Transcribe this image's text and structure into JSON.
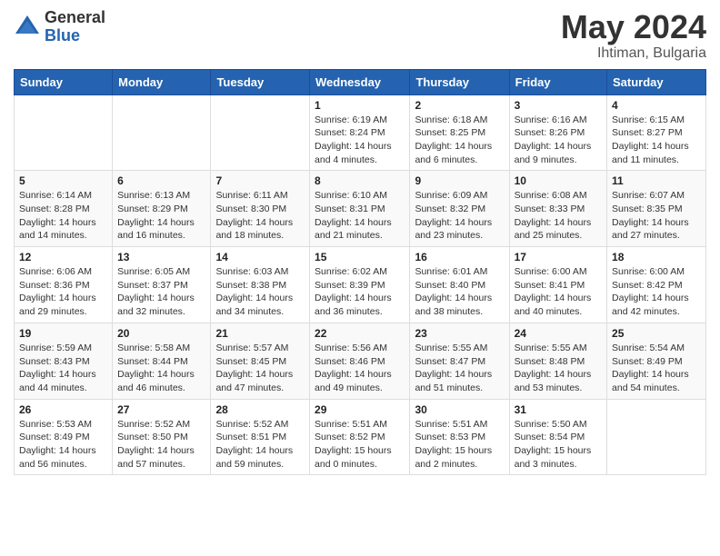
{
  "header": {
    "logo_general": "General",
    "logo_blue": "Blue",
    "title": "May 2024",
    "location": "Ihtiman, Bulgaria"
  },
  "days_of_week": [
    "Sunday",
    "Monday",
    "Tuesday",
    "Wednesday",
    "Thursday",
    "Friday",
    "Saturday"
  ],
  "weeks": [
    [
      {
        "num": "",
        "info": ""
      },
      {
        "num": "",
        "info": ""
      },
      {
        "num": "",
        "info": ""
      },
      {
        "num": "1",
        "info": "Sunrise: 6:19 AM\nSunset: 8:24 PM\nDaylight: 14 hours\nand 4 minutes."
      },
      {
        "num": "2",
        "info": "Sunrise: 6:18 AM\nSunset: 8:25 PM\nDaylight: 14 hours\nand 6 minutes."
      },
      {
        "num": "3",
        "info": "Sunrise: 6:16 AM\nSunset: 8:26 PM\nDaylight: 14 hours\nand 9 minutes."
      },
      {
        "num": "4",
        "info": "Sunrise: 6:15 AM\nSunset: 8:27 PM\nDaylight: 14 hours\nand 11 minutes."
      }
    ],
    [
      {
        "num": "5",
        "info": "Sunrise: 6:14 AM\nSunset: 8:28 PM\nDaylight: 14 hours\nand 14 minutes."
      },
      {
        "num": "6",
        "info": "Sunrise: 6:13 AM\nSunset: 8:29 PM\nDaylight: 14 hours\nand 16 minutes."
      },
      {
        "num": "7",
        "info": "Sunrise: 6:11 AM\nSunset: 8:30 PM\nDaylight: 14 hours\nand 18 minutes."
      },
      {
        "num": "8",
        "info": "Sunrise: 6:10 AM\nSunset: 8:31 PM\nDaylight: 14 hours\nand 21 minutes."
      },
      {
        "num": "9",
        "info": "Sunrise: 6:09 AM\nSunset: 8:32 PM\nDaylight: 14 hours\nand 23 minutes."
      },
      {
        "num": "10",
        "info": "Sunrise: 6:08 AM\nSunset: 8:33 PM\nDaylight: 14 hours\nand 25 minutes."
      },
      {
        "num": "11",
        "info": "Sunrise: 6:07 AM\nSunset: 8:35 PM\nDaylight: 14 hours\nand 27 minutes."
      }
    ],
    [
      {
        "num": "12",
        "info": "Sunrise: 6:06 AM\nSunset: 8:36 PM\nDaylight: 14 hours\nand 29 minutes."
      },
      {
        "num": "13",
        "info": "Sunrise: 6:05 AM\nSunset: 8:37 PM\nDaylight: 14 hours\nand 32 minutes."
      },
      {
        "num": "14",
        "info": "Sunrise: 6:03 AM\nSunset: 8:38 PM\nDaylight: 14 hours\nand 34 minutes."
      },
      {
        "num": "15",
        "info": "Sunrise: 6:02 AM\nSunset: 8:39 PM\nDaylight: 14 hours\nand 36 minutes."
      },
      {
        "num": "16",
        "info": "Sunrise: 6:01 AM\nSunset: 8:40 PM\nDaylight: 14 hours\nand 38 minutes."
      },
      {
        "num": "17",
        "info": "Sunrise: 6:00 AM\nSunset: 8:41 PM\nDaylight: 14 hours\nand 40 minutes."
      },
      {
        "num": "18",
        "info": "Sunrise: 6:00 AM\nSunset: 8:42 PM\nDaylight: 14 hours\nand 42 minutes."
      }
    ],
    [
      {
        "num": "19",
        "info": "Sunrise: 5:59 AM\nSunset: 8:43 PM\nDaylight: 14 hours\nand 44 minutes."
      },
      {
        "num": "20",
        "info": "Sunrise: 5:58 AM\nSunset: 8:44 PM\nDaylight: 14 hours\nand 46 minutes."
      },
      {
        "num": "21",
        "info": "Sunrise: 5:57 AM\nSunset: 8:45 PM\nDaylight: 14 hours\nand 47 minutes."
      },
      {
        "num": "22",
        "info": "Sunrise: 5:56 AM\nSunset: 8:46 PM\nDaylight: 14 hours\nand 49 minutes."
      },
      {
        "num": "23",
        "info": "Sunrise: 5:55 AM\nSunset: 8:47 PM\nDaylight: 14 hours\nand 51 minutes."
      },
      {
        "num": "24",
        "info": "Sunrise: 5:55 AM\nSunset: 8:48 PM\nDaylight: 14 hours\nand 53 minutes."
      },
      {
        "num": "25",
        "info": "Sunrise: 5:54 AM\nSunset: 8:49 PM\nDaylight: 14 hours\nand 54 minutes."
      }
    ],
    [
      {
        "num": "26",
        "info": "Sunrise: 5:53 AM\nSunset: 8:49 PM\nDaylight: 14 hours\nand 56 minutes."
      },
      {
        "num": "27",
        "info": "Sunrise: 5:52 AM\nSunset: 8:50 PM\nDaylight: 14 hours\nand 57 minutes."
      },
      {
        "num": "28",
        "info": "Sunrise: 5:52 AM\nSunset: 8:51 PM\nDaylight: 14 hours\nand 59 minutes."
      },
      {
        "num": "29",
        "info": "Sunrise: 5:51 AM\nSunset: 8:52 PM\nDaylight: 15 hours\nand 0 minutes."
      },
      {
        "num": "30",
        "info": "Sunrise: 5:51 AM\nSunset: 8:53 PM\nDaylight: 15 hours\nand 2 minutes."
      },
      {
        "num": "31",
        "info": "Sunrise: 5:50 AM\nSunset: 8:54 PM\nDaylight: 15 hours\nand 3 minutes."
      },
      {
        "num": "",
        "info": ""
      }
    ]
  ]
}
